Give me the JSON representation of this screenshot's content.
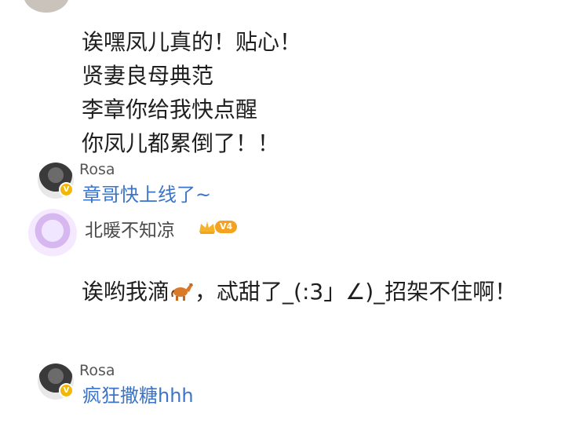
{
  "top_comment": {
    "lines": [
      "诶嘿凤儿真的！贴心！",
      "贤妻良母典范",
      "李章你给我快点醒",
      "你凤儿都累倒了！！"
    ]
  },
  "reply_1": {
    "username": "Rosa",
    "badge": "V",
    "text": "章哥快上线了~"
  },
  "comment_2": {
    "username": "北暖不知凉",
    "vip_level": "V4",
    "text_before_icon": "诶哟我滴",
    "text_after_icon": "，忒甜了_(:3」∠)_招架不住啊！"
  },
  "reply_2": {
    "username": "Rosa",
    "badge": "V",
    "text": "疯狂撒糖hhh"
  },
  "icons": {
    "horse": "horse-icon",
    "crown": "crown-icon"
  },
  "colors": {
    "reply_text": "#3b74c8",
    "vip": "#f4a321",
    "verified": "#f2b707"
  }
}
